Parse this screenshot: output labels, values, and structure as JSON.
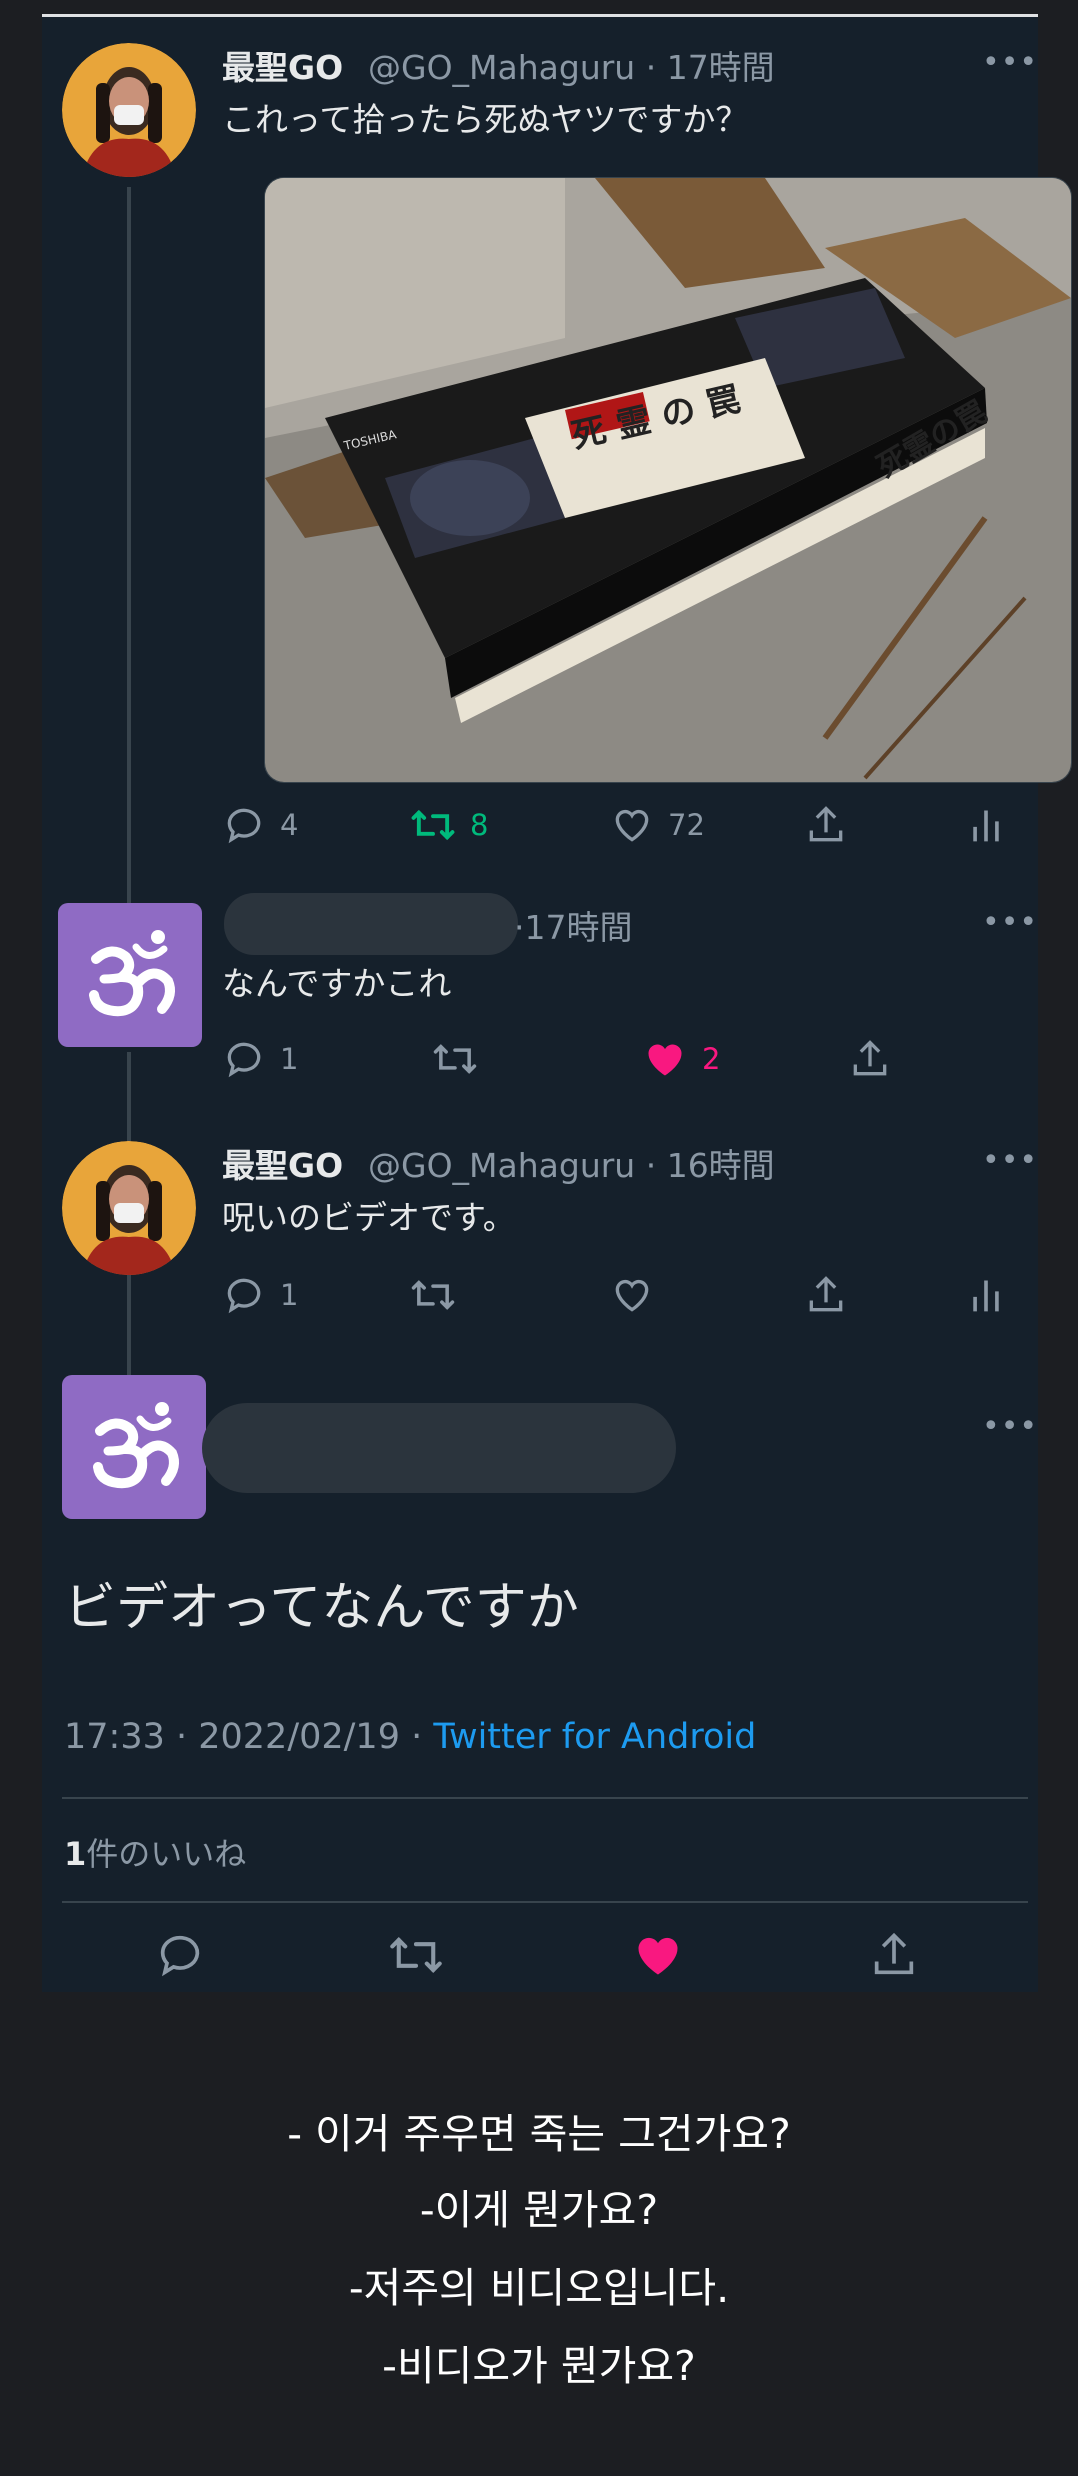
{
  "tweet1": {
    "display_name": "最聖GO",
    "handle_time": "@GO_Mahaguru · 17時間",
    "text": "これって拾ったら死ぬヤツですか？",
    "more": "•••",
    "photo_labels": {
      "brand": "TOSHIBA",
      "title": "死 霊 の 罠",
      "spine": "死霊の罠"
    },
    "replies": "4",
    "retweets": "8",
    "likes": "72"
  },
  "reply1": {
    "time": "·17時間",
    "text": "なんですかこれ",
    "more": "•••",
    "replies": "1",
    "likes": "2"
  },
  "reply2": {
    "display_name": "最聖GO",
    "handle_time": "@GO_Mahaguru · 16時間",
    "text": "呪いのビデオです。",
    "more": "•••",
    "replies": "1"
  },
  "focus": {
    "text": "ビデオってなんですか",
    "timestamp": "17:33 · 2022/02/19 · ",
    "source": "Twitter for Android",
    "likes_count": "1",
    "likes_label": "件のいいね",
    "more": "•••"
  },
  "captions": [
    "- 이거 주우면 죽는 그건가요?",
    "-이게 뭔가요?",
    "-저주의 비디오입니다.",
    "-비디오가 뭔가요?"
  ],
  "colors": {
    "background": "#15202b",
    "retweet_active": "#00ba7c",
    "like_active": "#f91880",
    "link": "#1d9bf0",
    "om_avatar": "#8f6bc4"
  },
  "icons": [
    "reply-icon",
    "retweet-icon",
    "like-icon",
    "share-icon",
    "analytics-icon",
    "om-icon",
    "more-icon"
  ]
}
